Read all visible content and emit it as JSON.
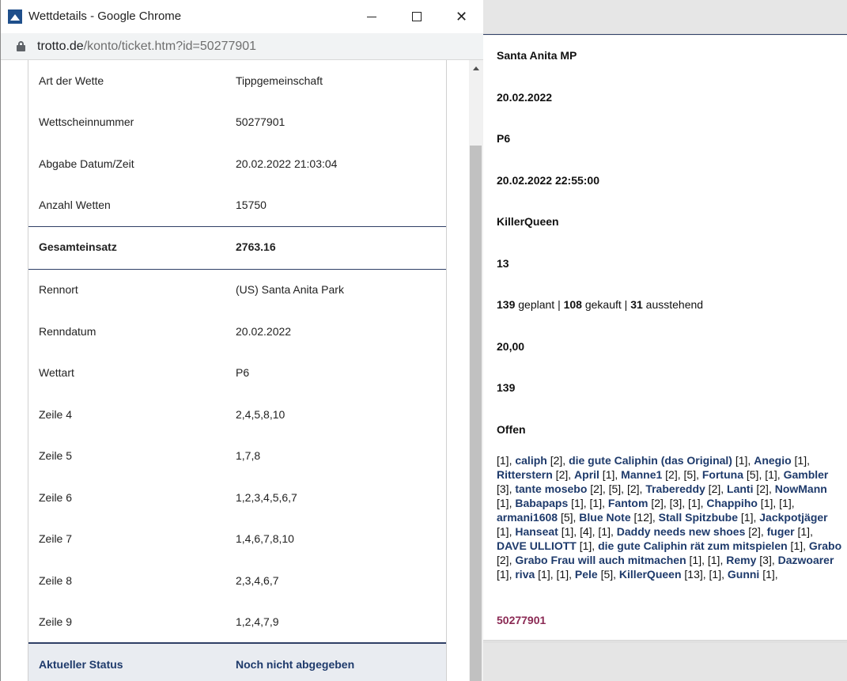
{
  "window": {
    "title": "Wettdetails - Google Chrome",
    "url_host": "trotto.de",
    "url_path": "/konto/ticket.htm?id=50277901"
  },
  "details": [
    {
      "label": "Art der Wette",
      "value": "Tippgemeinschaft"
    },
    {
      "label": "Wettscheinnummer",
      "value": "50277901"
    },
    {
      "label": "Abgabe Datum/Zeit",
      "value": "20.02.2022 21:03:04"
    },
    {
      "label": "Anzahl Wetten",
      "value": "15750"
    },
    {
      "label": "Gesamteinsatz",
      "value": "2763.16"
    },
    {
      "label": "Rennort",
      "value": "(US) Santa Anita Park"
    },
    {
      "label": "Renndatum",
      "value": "20.02.2022"
    },
    {
      "label": "Wettart",
      "value": "P6"
    },
    {
      "label": "Zeile 4",
      "value": "2,4,5,8,10"
    },
    {
      "label": "Zeile 5",
      "value": "1,7,8"
    },
    {
      "label": "Zeile 6",
      "value": "1,2,3,4,5,6,7"
    },
    {
      "label": "Zeile 7",
      "value": "1,4,6,7,8,10"
    },
    {
      "label": "Zeile 8",
      "value": "2,3,4,6,7"
    },
    {
      "label": "Zeile 9",
      "value": "1,2,4,7,9"
    }
  ],
  "status": {
    "label": "Aktueller Status",
    "value": "Noch nicht abgegeben"
  },
  "background": {
    "track": "Santa Anita MP",
    "date": "20.02.2022",
    "bet_type": "P6",
    "race_time": "20.02.2022 22:55:00",
    "organizer": "KillerQueen",
    "participants": "13",
    "shares_planned": "139",
    "shares_planned_label": "geplant |",
    "shares_bought": "108",
    "shares_bought_label": "gekauft |",
    "shares_pending": "31",
    "shares_pending_label": "ausstehend",
    "share_price": "20,00",
    "share_count": "139",
    "state": "Offen",
    "ticket": "50277901",
    "members": [
      {
        "pre": "[1], ",
        "name": "caliph"
      },
      {
        "pre": " [2], ",
        "name": "die gute Caliphin (das Original)"
      },
      {
        "pre": " [1], ",
        "name": "Anegio"
      },
      {
        "pre": " [1], ",
        "name": "Ritterstern"
      },
      {
        "pre": " [2], ",
        "name": "April"
      },
      {
        "pre": " [1], ",
        "name": "Manne1"
      },
      {
        "pre": " [2], [5], ",
        "name": "Fortuna"
      },
      {
        "pre": " [5], [1], ",
        "name": "Gambler"
      },
      {
        "pre": " [3], ",
        "name": "tante mosebo"
      },
      {
        "pre": " [2], [5], [2], ",
        "name": "Trabereddy"
      },
      {
        "pre": " [2], ",
        "name": "Lanti"
      },
      {
        "pre": " [2], ",
        "name": "NowMann"
      },
      {
        "pre": " [1], ",
        "name": "Babapaps"
      },
      {
        "pre": " [1], [1], ",
        "name": "Fantom"
      },
      {
        "pre": " [2], [3], [1], ",
        "name": "Chappiho"
      },
      {
        "pre": " [1], [1], ",
        "name": "armani1608"
      },
      {
        "pre": " [5], ",
        "name": "Blue Note"
      },
      {
        "pre": " [12], ",
        "name": "Stall Spitzbube"
      },
      {
        "pre": " [1], ",
        "name": "Jackpotjäger"
      },
      {
        "pre": " [1], ",
        "name": "Hanseat"
      },
      {
        "pre": " [1], [4], [1], ",
        "name": "Daddy needs new shoes"
      },
      {
        "pre": " [2], ",
        "name": "fuger"
      },
      {
        "pre": " [1], ",
        "name": "DAVE ULLIOTT"
      },
      {
        "pre": " [1], ",
        "name": "die gute Caliphin rät zum mitspielen"
      },
      {
        "pre": " [1], ",
        "name": "Grabo"
      },
      {
        "pre": " [2], ",
        "name": "Grabo Frau will auch mitmachen"
      },
      {
        "pre": " [1], [1], ",
        "name": "Remy"
      },
      {
        "pre": " [3], ",
        "name": "Dazwoarer"
      },
      {
        "pre": " [1], ",
        "name": "riva"
      },
      {
        "pre": " [1], [1], ",
        "name": "Pele"
      },
      {
        "pre": " [5], ",
        "name": "KillerQueen"
      },
      {
        "pre": " [13], [1], ",
        "name": "Gunni"
      }
    ],
    "members_tail": " [1],"
  }
}
